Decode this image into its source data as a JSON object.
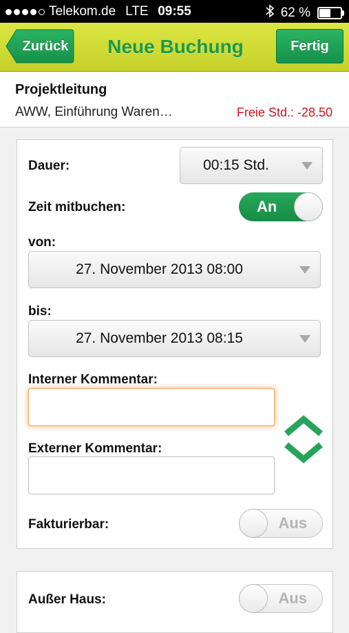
{
  "status_bar": {
    "carrier": "Telekom.de",
    "network": "LTE",
    "time": "09:55",
    "battery": "62 %",
    "battery_level": 0.62,
    "signal_bars": 4,
    "signal_max": 5,
    "icons": [
      "bluetooth-icon",
      "battery-icon"
    ]
  },
  "nav": {
    "back_label": "Zurück",
    "title": "Neue Buchung",
    "done_label": "Fertig"
  },
  "header": {
    "project": "Projektleitung",
    "subtitle": "AWW, Einführung Waren…",
    "free_hours": "Freie Std.: -28.50"
  },
  "form": {
    "duration_label": "Dauer:",
    "duration_value": "00:15 Std.",
    "book_time_label": "Zeit mitbuchen:",
    "book_time_toggle": "An",
    "from_label": "von:",
    "from_value": "27. November 2013 08:00",
    "to_label": "bis:",
    "to_value": "27. November 2013 08:15",
    "internal_comment_label": "Interner Kommentar:",
    "internal_comment_value": "",
    "external_comment_label": "Externer Kommentar:",
    "external_comment_value": "",
    "billable_label": "Fakturierbar:",
    "billable_toggle": "Aus",
    "out_of_office_label": "Außer Haus:",
    "out_of_office_toggle": "Aus"
  },
  "colors": {
    "navbar": "#cfdb34",
    "accent_green": "#1c9a4d",
    "warning_red": "#d0141c",
    "focus_orange": "#f0a15c"
  }
}
